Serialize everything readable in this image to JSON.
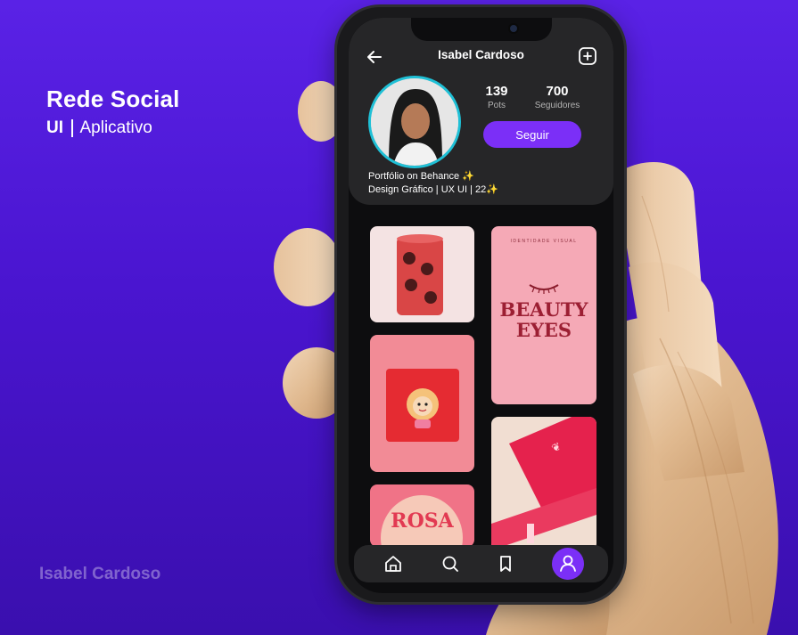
{
  "hero": {
    "title": "Rede Social",
    "sub_bold": "UI",
    "sub_rest": "Aplicativo"
  },
  "watermark": "Isabel Cardoso",
  "profile": {
    "name": "Isabel Cardoso",
    "stats": [
      {
        "value": "139",
        "label": "Pots"
      },
      {
        "value": "700",
        "label": "Seguidores"
      }
    ],
    "follow_label": "Seguir",
    "bio_line1": "Portfólio on Behance ✨",
    "bio_line2": "Design Gráfico | UX UI | 22✨"
  },
  "posts": {
    "beauty_top": "IDENTIDADE VISUAL",
    "beauty_title1": "BEAUTY",
    "beauty_title2": "EYES",
    "rosa": "ROSA"
  },
  "nav": [
    "home-icon",
    "search-icon",
    "bookmark-icon",
    "profile-icon"
  ],
  "colors": {
    "accent": "#7b2ff7",
    "background": "#4a15d0",
    "card": "#262628",
    "avatar_ring": "#1fc0d6"
  }
}
